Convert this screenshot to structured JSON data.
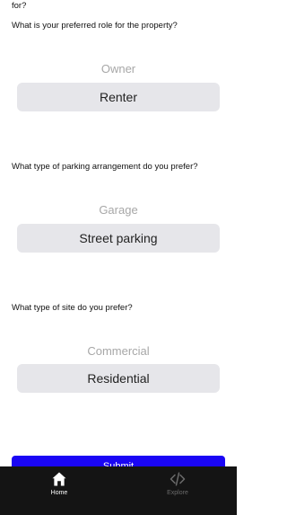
{
  "top_fragment": "for?",
  "questions": [
    {
      "text": "What is your preferred role for the property?",
      "option_above": "Owner",
      "selected": "Renter"
    },
    {
      "text": "What type of parking arrangement do you prefer?",
      "option_above": "Garage",
      "selected": "Street parking"
    },
    {
      "text": "What type of site do you prefer?",
      "option_above": "Commercial",
      "selected": "Residential"
    }
  ],
  "submit_label": "Submit",
  "tabs": [
    {
      "label": "Home",
      "icon": "home-icon",
      "active": true
    },
    {
      "label": "Explore",
      "icon": "code-icon",
      "active": false
    }
  ],
  "colors": {
    "accent": "#1a06f5",
    "tabbar": "#141414",
    "active_tab": "#ffffff",
    "inactive_tab": "#6b6b6b"
  }
}
